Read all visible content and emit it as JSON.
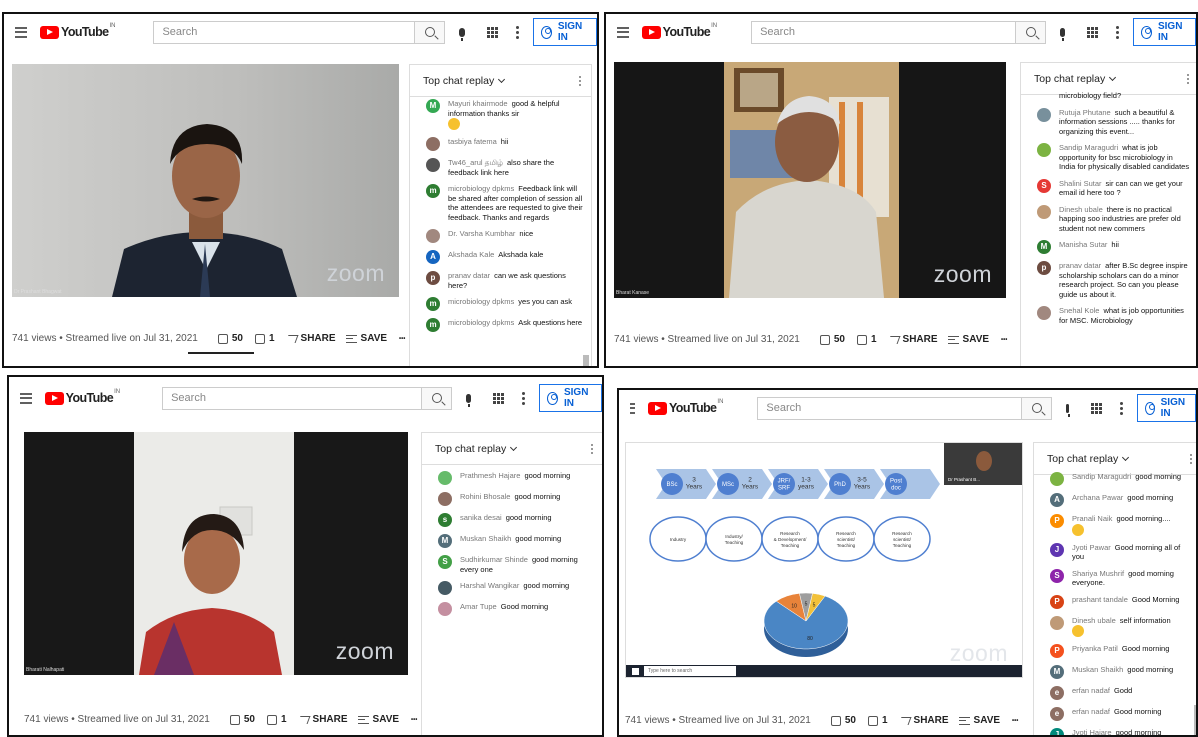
{
  "common": {
    "search_placeholder": "Search",
    "sign_in": "SIGN IN",
    "chat_header": "Top chat replay",
    "views": "741 views • Streamed live on Jul 31, 2021",
    "likes": "50",
    "dislikes": "1",
    "share": "SHARE",
    "save": "SAVE",
    "more": "•••",
    "zoom_logo": "zoom",
    "logo_text": "YouTube",
    "logo_sup": "IN"
  },
  "panel1": {
    "speaker": "Dr Prashant Bhagwat",
    "chat": [
      {
        "author": "Mayuri khairmode",
        "text": "good & helpful information thanks sir",
        "initial": "M",
        "color": "#34a853",
        "emoji": true
      },
      {
        "author": "tasbiya fatema",
        "text": "hii",
        "initial": "",
        "color": "#8d6e63"
      },
      {
        "author": "Tw46_arul தமிழ்",
        "text": "also share the feedback link here",
        "initial": "",
        "color": "#555555"
      },
      {
        "author": "microbiology dpkms",
        "text": "Feedback link will be shared after completion of session all the attendees are requested to give their feedback. Thanks and regards",
        "initial": "m",
        "color": "#2e7d32"
      },
      {
        "author": "Dr. Varsha Kumbhar",
        "text": "nice",
        "initial": "",
        "color": "#a1887f"
      },
      {
        "author": "Akshada Kale",
        "text": "Akshada kale",
        "initial": "A",
        "color": "#1565c0"
      },
      {
        "author": "pranav datar",
        "text": "can we ask questions here?",
        "initial": "p",
        "color": "#6d4c41"
      },
      {
        "author": "microbiology dpkms",
        "text": "yes you can ask",
        "initial": "m",
        "color": "#2e7d32"
      },
      {
        "author": "microbiology dpkms",
        "text": "Ask questions here",
        "initial": "m",
        "color": "#2e7d32"
      }
    ]
  },
  "panel2": {
    "speaker": "Bharat Kanase",
    "chat": [
      {
        "author": "",
        "text": "microbiology field?",
        "initial": "",
        "color": "",
        "partial": true
      },
      {
        "author": "Rutuja Phutane",
        "text": "such a beautiful & information sessions ..... thanks for organizing this event...",
        "initial": "",
        "color": "#78909c"
      },
      {
        "author": "Sandip Maragudri",
        "text": "what is job opportunity for bsc microbiology in India for physically disabled candidates",
        "initial": "",
        "color": "#7cb342"
      },
      {
        "author": "Shalini Sutar",
        "text": "sir can can we get your email id here too ?",
        "initial": "S",
        "color": "#e53935"
      },
      {
        "author": "Dinesh ubale",
        "text": "there is no practical happing soo industries are prefer old student not new commers",
        "initial": "",
        "color": "#bf9a77"
      },
      {
        "author": "Manisha Sutar",
        "text": "hii",
        "initial": "M",
        "color": "#2e7d32"
      },
      {
        "author": "pranav datar",
        "text": "after B.Sc degree inspire scholarship scholars can do a minor research project. So can you please guide us about it.",
        "initial": "p",
        "color": "#6d4c41"
      },
      {
        "author": "Snehal Kole",
        "text": "what is job opportunities for MSC. Microbiology",
        "initial": "",
        "color": "#a1887f"
      }
    ]
  },
  "panel3": {
    "speaker": "Bharati Nalhapati",
    "chat": [
      {
        "author": "Prathmesh Hajare",
        "text": "good morning",
        "initial": "",
        "color": "#66bb6a"
      },
      {
        "author": "Rohini Bhosale",
        "text": "good morning",
        "initial": "",
        "color": "#8d6e63"
      },
      {
        "author": "sanika desai",
        "text": "good morning",
        "initial": "s",
        "color": "#2e7d32"
      },
      {
        "author": "Muskan Shaikh",
        "text": "good morning",
        "initial": "M",
        "color": "#546e7a"
      },
      {
        "author": "Sudhirkumar Shinde",
        "text": "good morning every one",
        "initial": "S",
        "color": "#43a047"
      },
      {
        "author": "Harshal Wangikar",
        "text": "good morning",
        "initial": "",
        "color": "#455a64"
      },
      {
        "author": "Amar Tupe",
        "text": "Good morning",
        "initial": "",
        "color": "#c48fa0"
      }
    ]
  },
  "panel4": {
    "slide": {
      "steps": [
        {
          "title": "BSc",
          "years": "3 Years"
        },
        {
          "title": "MSc",
          "years": "2 Years"
        },
        {
          "title": "JRF/ SRF",
          "years": "1-3 years"
        },
        {
          "title": "PhD",
          "years": "3-5 Years"
        },
        {
          "title": "Post doc",
          "years": ""
        }
      ],
      "careers": [
        "Industry",
        "Industry/ Teaching",
        "Research & Development/ Teaching",
        "Research scientist/ Teaching",
        "Research scientist/ Teaching"
      ],
      "pie_labels": [
        "10",
        "5",
        "5",
        "80"
      ],
      "thumb_label": "Dr Prashant B...",
      "taskbar_search": "Type here to search"
    },
    "chart_data": {
      "type": "pie",
      "categories": [
        "",
        "",
        "",
        ""
      ],
      "values": [
        80,
        10,
        5,
        5
      ],
      "colors": [
        "#4a86c5",
        "#e8833a",
        "#9e9e9e",
        "#f2c13a"
      ]
    },
    "chat": [
      {
        "author": "Sandip Maragudri",
        "text": "good morning",
        "initial": "",
        "color": "#7cb342",
        "partial": true
      },
      {
        "author": "Archana Pawar",
        "text": "good morning",
        "initial": "A",
        "color": "#546e7a"
      },
      {
        "author": "Pranali Naik",
        "text": "good morning....",
        "initial": "P",
        "color": "#fb8c00",
        "emoji": true
      },
      {
        "author": "Jyoti Pawar",
        "text": "Good morning all of you",
        "initial": "J",
        "color": "#5e35b1"
      },
      {
        "author": "Shariya Mushrif",
        "text": "good morning everyone.",
        "initial": "S",
        "color": "#8e24aa"
      },
      {
        "author": "prashant tandale",
        "text": "Good Morning",
        "initial": "P",
        "color": "#d84315"
      },
      {
        "author": "Dinesh ubale",
        "text": "self information",
        "initial": "",
        "color": "#bf9a77",
        "emoji": true
      },
      {
        "author": "Priyanka Patil",
        "text": "Good morning",
        "initial": "P",
        "color": "#f4511e"
      },
      {
        "author": "Muskan Shaikh",
        "text": "good morning",
        "initial": "M",
        "color": "#546e7a"
      },
      {
        "author": "erfan nadaf",
        "text": "Godd",
        "initial": "e",
        "color": "#8d6e63"
      },
      {
        "author": "erfan nadaf",
        "text": "Good morning",
        "initial": "e",
        "color": "#8d6e63"
      },
      {
        "author": "Jyoti Hajare",
        "text": "good morning",
        "initial": "J",
        "color": "#00897b"
      }
    ]
  }
}
